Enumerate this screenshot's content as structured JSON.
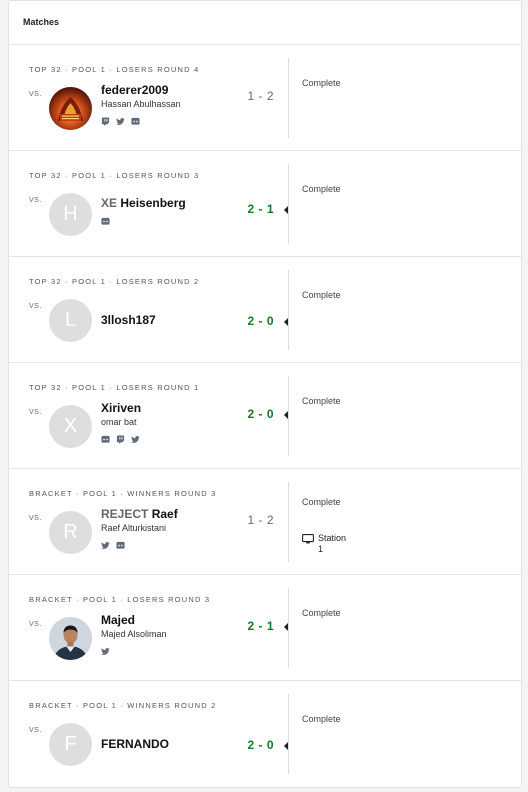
{
  "header": {
    "title": "Matches"
  },
  "matches": [
    {
      "phase": "TOP 32 · POOL 1 · LOSERS ROUND 4",
      "vs": "VS.",
      "avatar_letter": "",
      "avatar_kind": "image-fire",
      "prefix": "",
      "gamertag": "federer2009",
      "real_name": "Hassan Abulhassan",
      "socials": [
        "twitch-icon",
        "twitter-icon",
        "discord-icon"
      ],
      "score": "1 - 2",
      "result": "loss",
      "status": "Complete"
    },
    {
      "phase": "TOP 32 · POOL 1 · LOSERS ROUND 3",
      "vs": "VS.",
      "avatar_letter": "H",
      "prefix": "XE",
      "gamertag": "Heisenberg",
      "real_name": "",
      "socials": [
        "discord-icon"
      ],
      "score": "2 - 1",
      "result": "win",
      "status": "Complete"
    },
    {
      "phase": "TOP 32 · POOL 1 · LOSERS ROUND 2",
      "vs": "VS.",
      "avatar_letter": "L",
      "prefix": "",
      "gamertag": "3llosh187",
      "real_name": "",
      "socials": [],
      "score": "2 - 0",
      "result": "win",
      "status": "Complete"
    },
    {
      "phase": "TOP 32 · POOL 1 · LOSERS ROUND 1",
      "vs": "VS.",
      "avatar_letter": "X",
      "prefix": "",
      "gamertag": "Xiriven",
      "real_name": "omar bat",
      "socials": [
        "discord-icon",
        "twitch-icon",
        "twitter-icon"
      ],
      "score": "2 - 0",
      "result": "win",
      "status": "Complete"
    },
    {
      "phase": "BRACKET · POOL 1 · WINNERS ROUND 3",
      "vs": "VS.",
      "avatar_letter": "R",
      "prefix": "REJECT",
      "gamertag": "Raef",
      "real_name": "Raef Alturkistani",
      "socials": [
        "twitter-icon",
        "discord-icon"
      ],
      "score": "1 - 2",
      "result": "loss",
      "status": "Complete",
      "station": "Station 1"
    },
    {
      "phase": "BRACKET · POOL 1 · LOSERS ROUND 3",
      "vs": "VS.",
      "avatar_letter": "",
      "avatar_kind": "image-person",
      "prefix": "",
      "gamertag": "Majed",
      "real_name": "Majed Alsoliman",
      "socials": [
        "twitter-icon"
      ],
      "score": "2 - 1",
      "result": "win",
      "status": "Complete"
    },
    {
      "phase": "BRACKET · POOL 1 · WINNERS ROUND 2",
      "vs": "VS.",
      "avatar_letter": "F",
      "prefix": "",
      "gamertag": "FERNANDO",
      "real_name": "",
      "socials": [],
      "score": "2 - 0",
      "result": "win",
      "status": "Complete"
    }
  ]
}
